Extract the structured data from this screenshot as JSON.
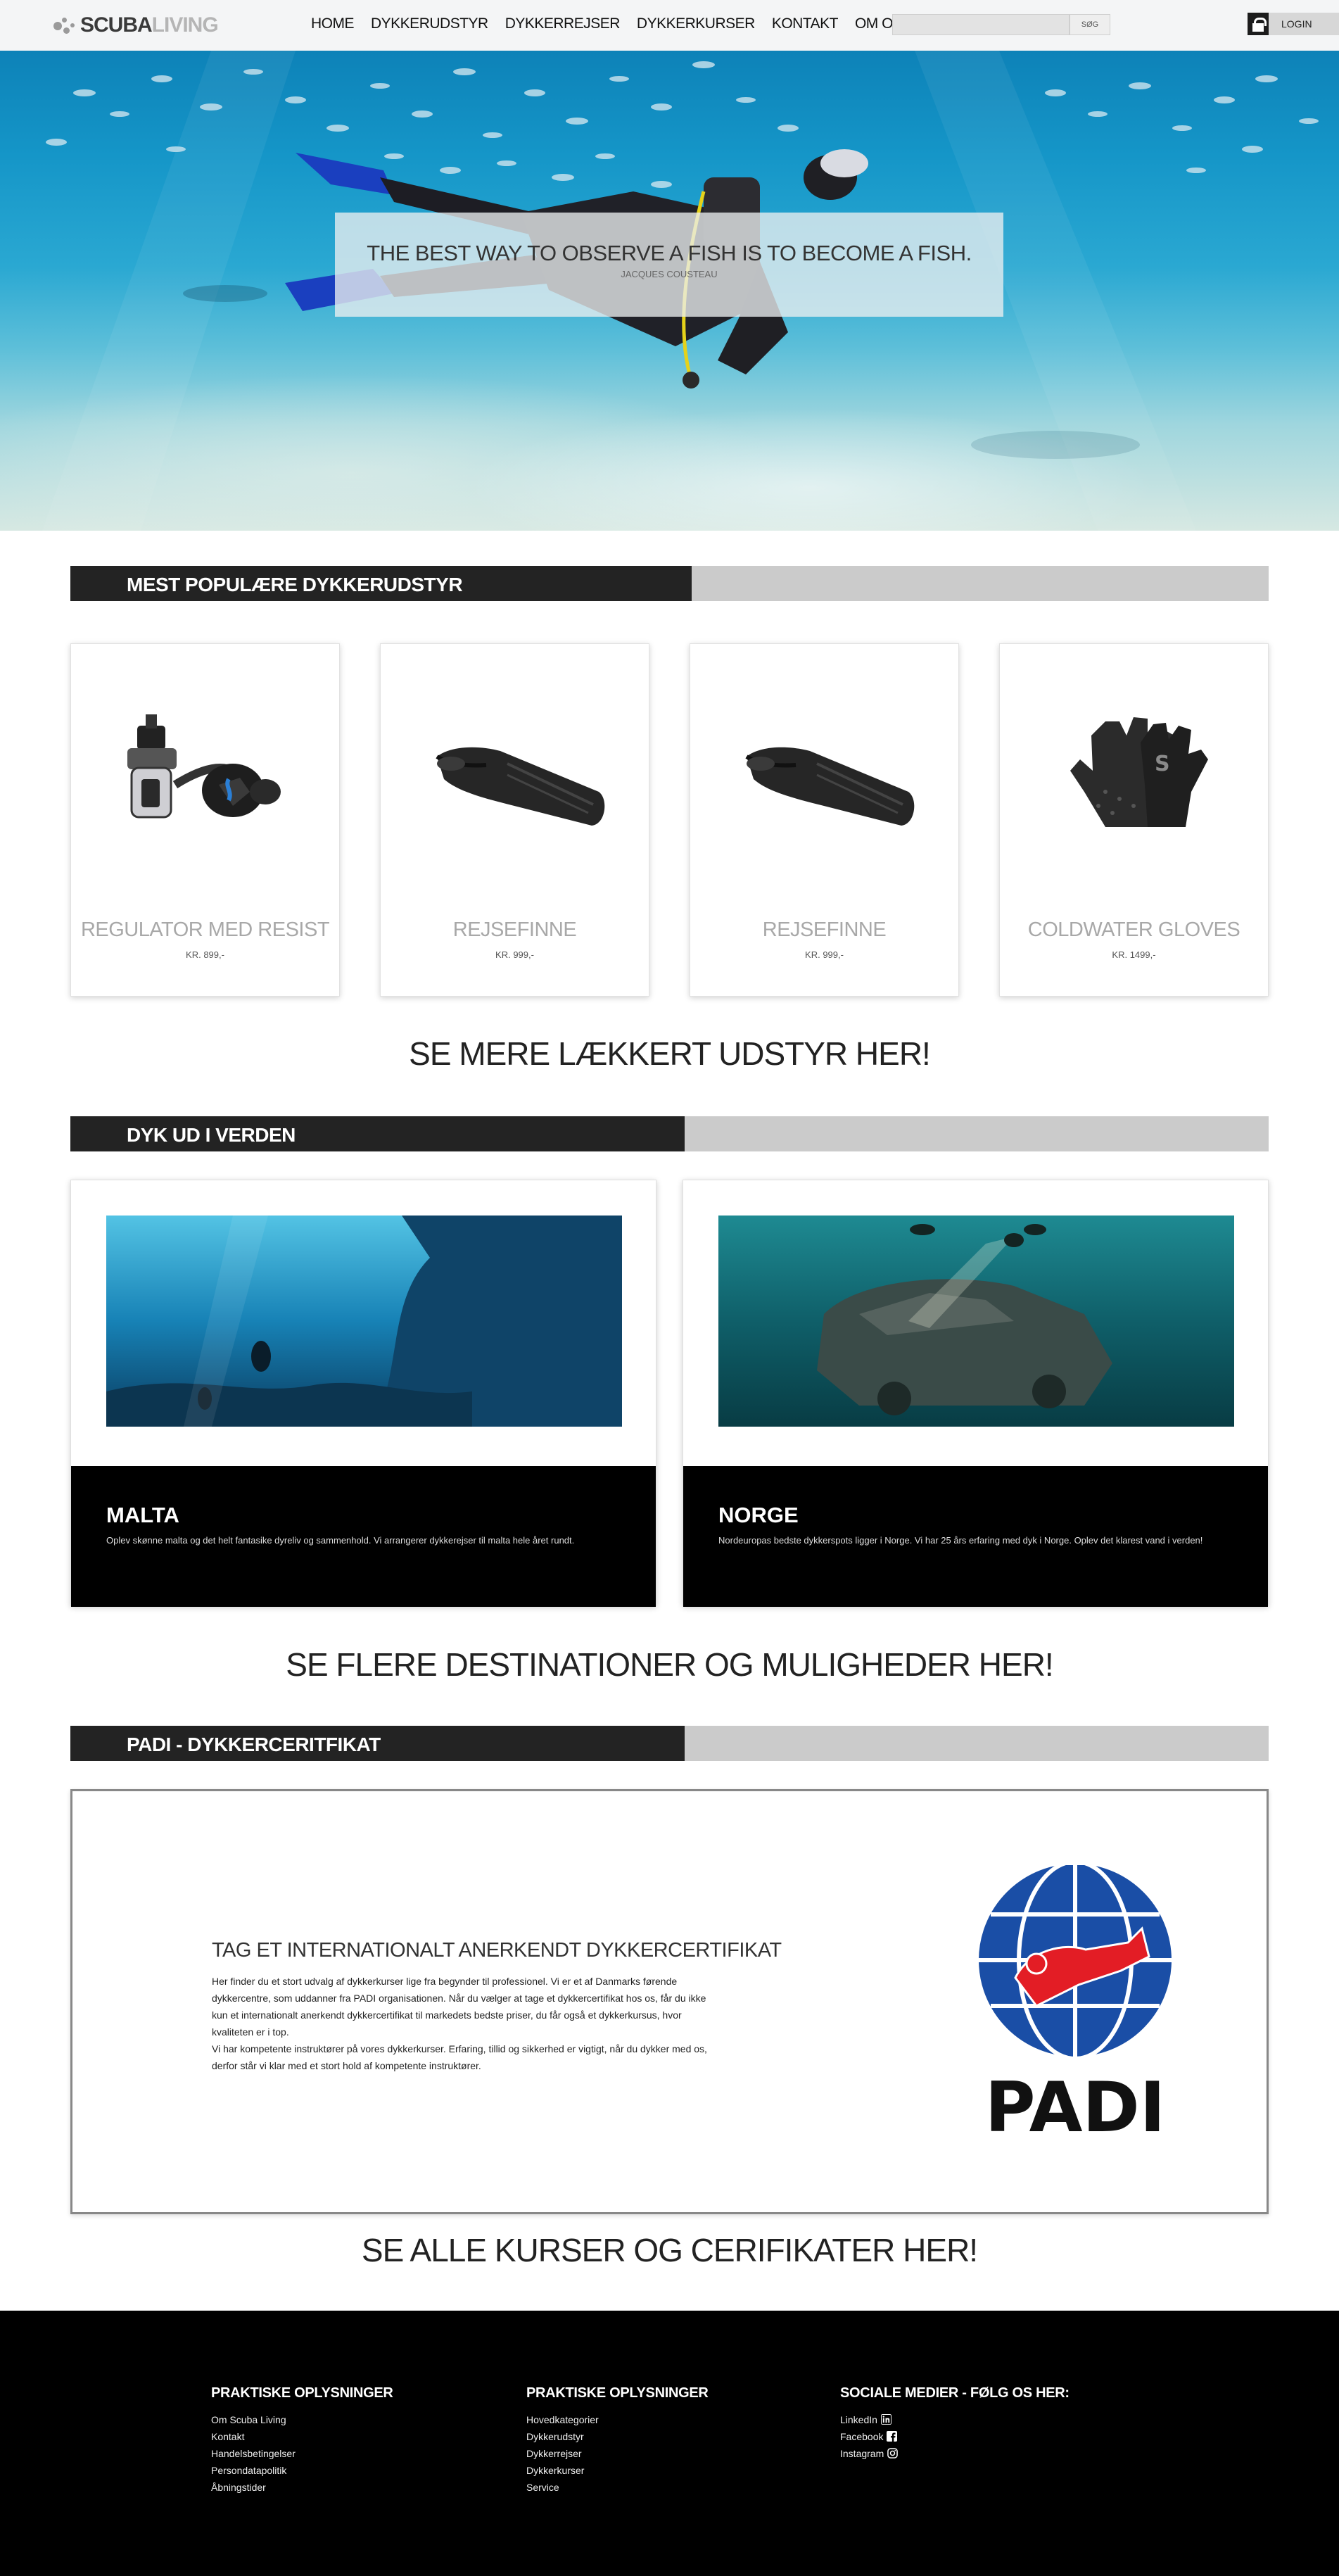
{
  "nav": {
    "logo_part1": "SCUBA",
    "logo_part2": "LIVING",
    "items": [
      "HOME",
      "DYKKERUDSTYR",
      "DYKKERREJSER",
      "DYKKERKURSER",
      "KONTAKT",
      "OM OS"
    ],
    "search_button": "SØG",
    "login": "LOGIN"
  },
  "hero": {
    "quote": "THE BEST WAY TO OBSERVE A FISH IS TO BECOME A FISH.",
    "author": "JACQUES COUSTEAU"
  },
  "popular": {
    "heading": "MEST POPULÆRE DYKKERUDSTYR",
    "products": [
      {
        "name": "REGULATOR MED RESIST",
        "price": "KR. 899,-"
      },
      {
        "name": "REJSEFINNE",
        "price": "KR. 999,-"
      },
      {
        "name": "REJSEFINNE",
        "price": "KR. 999,-"
      },
      {
        "name": "COLDWATER GLOVES",
        "price": "KR. 1499,-"
      }
    ],
    "more_link": "SE MERE LÆKKERT UDSTYR HER!"
  },
  "destinations": {
    "heading": "DYK UD I VERDEN",
    "items": [
      {
        "title": "MALTA",
        "text": "Oplev skønne malta og det helt fantasike dyreliv og sammenhold. Vi arrangerer dykkerejser til malta hele året rundt."
      },
      {
        "title": "NORGE",
        "text": "Nordeuropas bedste dykkerspots ligger i Norge. Vi har 25 års erfaring med dyk i Norge. Oplev det klarest vand i verden!"
      }
    ],
    "more_link": "SE FLERE DESTINATIONER OG MULIGHEDER HER!"
  },
  "padi": {
    "heading": "PADI - DYKKERCERITFIKAT",
    "title": "TAG ET INTERNATIONALT ANERKENDT DYKKERCERTIFIKAT",
    "paragraph1": "Her finder du et stort udvalg af dykkerkurser lige fra begynder til professionel. Vi er et af Danmarks førende dykkercentre, som uddanner fra PADI organisationen. Når du vælger at tage et dykkercertifikat hos os, får du ikke kun et internationalt anerkendt dykkercertifikat til markedets bedste priser, du får også et dykkerkursus, hvor kvaliteten er i top.",
    "paragraph2": "Vi har kompetente instruktører på vores dykkerkurser. Erfaring, tillid og sikkerhed er vigtigt, når du dykker med os, derfor står vi klar med et stort hold af kompetente instruktører.",
    "logo_text": "PADI",
    "more_link": "SE ALLE KURSER OG CERIFIKATER HER!"
  },
  "footer": {
    "col1": {
      "heading": "PRAKTISKE OPLYSNINGER",
      "links": [
        "Om Scuba Living",
        "Kontakt",
        "Handelsbetingelser",
        "Persondatapolitik",
        "Åbningstider"
      ]
    },
    "col2": {
      "heading": "PRAKTISKE OPLYSNINGER",
      "links": [
        "Hovedkategorier",
        "Dykkerudstyr",
        "Dykkerrejser",
        "Dykkerkurser",
        "Service"
      ]
    },
    "col3": {
      "heading": "SOCIALE MEDIER - FØLG OS HER:",
      "links": [
        "LinkedIn",
        "Facebook",
        "Instagram"
      ]
    }
  }
}
